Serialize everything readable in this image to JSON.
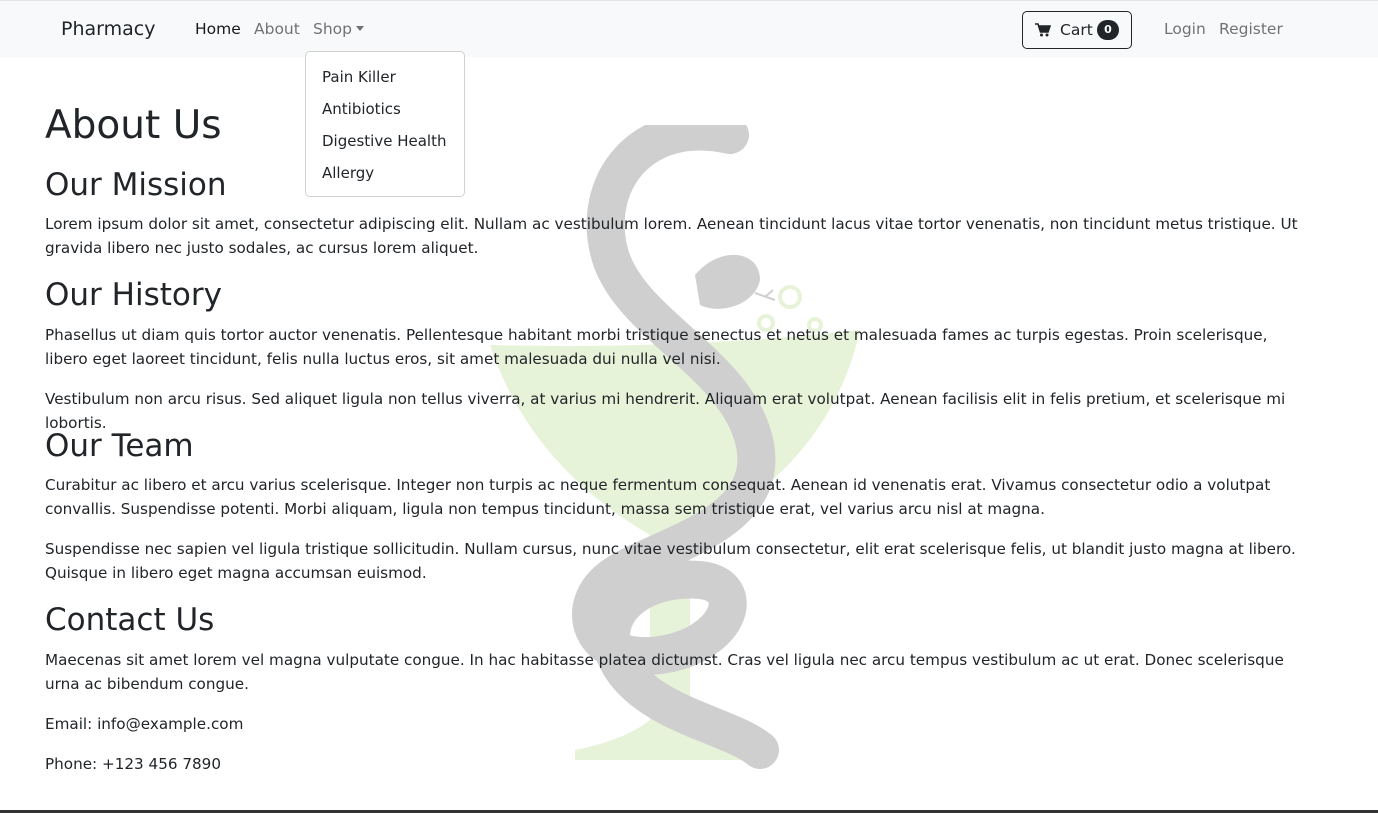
{
  "nav": {
    "brand": "Pharmacy",
    "links": {
      "home": "Home",
      "about": "About",
      "shop": "Shop",
      "login": "Login",
      "register": "Register"
    },
    "cart": {
      "label": "Cart",
      "count": "0"
    }
  },
  "shop_dropdown": {
    "items": [
      "Pain Killer",
      "Antibiotics",
      "Digestive Health",
      "Allergy"
    ]
  },
  "main": {
    "title": "About Us",
    "mission": {
      "heading": "Our Mission",
      "text": "Lorem ipsum dolor sit amet, consectetur adipiscing elit. Nullam ac vestibulum lorem. Aenean tincidunt lacus vitae tortor venenatis, non tincidunt metus tristique. Ut gravida libero nec justo sodales, ac cursus lorem aliquet."
    },
    "history": {
      "heading": "Our History",
      "text1": "Phasellus ut diam quis tortor auctor venenatis. Pellentesque habitant morbi tristique senectus et netus et malesuada fames ac turpis egestas. Proin scelerisque, libero eget laoreet tincidunt, felis nulla luctus eros, sit amet malesuada dui nulla vel nisi.",
      "text2": "Vestibulum non arcu risus. Sed aliquet ligula non tellus viverra, at varius mi hendrerit. Aliquam erat volutpat. Aenean facilisis elit in felis pretium, et scelerisque mi lobortis."
    },
    "team": {
      "heading": "Our Team",
      "text1": "Curabitur ac libero et arcu varius scelerisque. Integer non turpis ac neque fermentum consequat. Aenean id venenatis erat. Vivamus consectetur odio a volutpat convallis. Suspendisse potenti. Morbi aliquam, ligula non tempus tincidunt, massa sem tristique erat, vel varius arcu nisl at magna.",
      "text2": "Suspendisse nec sapien vel ligula tristique sollicitudin. Nullam cursus, nunc vitae vestibulum consectetur, elit erat scelerisque felis, ut blandit justo magna at libero. Quisque in libero eget magna accumsan euismod."
    },
    "contact": {
      "heading": "Contact Us",
      "text": "Maecenas sit amet lorem vel magna vulputate congue. In hac habitasse platea dictumst. Cras vel ligula nec arcu tempus vestibulum ac ut erat. Donec scelerisque urna ac bibendum congue.",
      "email": "Email: info@example.com",
      "phone": "Phone: +123 456 7890"
    }
  },
  "icons": {
    "cart": "cart-icon",
    "caret": "caret-down-icon",
    "watermark": "pharmacy-bowl-snake-icon"
  },
  "colors": {
    "navbar_bg": "#f8f9fa",
    "text": "#212529",
    "muted_link": "#737373",
    "bowl": "#e6f3d8",
    "snake": "#cfcfcf"
  }
}
